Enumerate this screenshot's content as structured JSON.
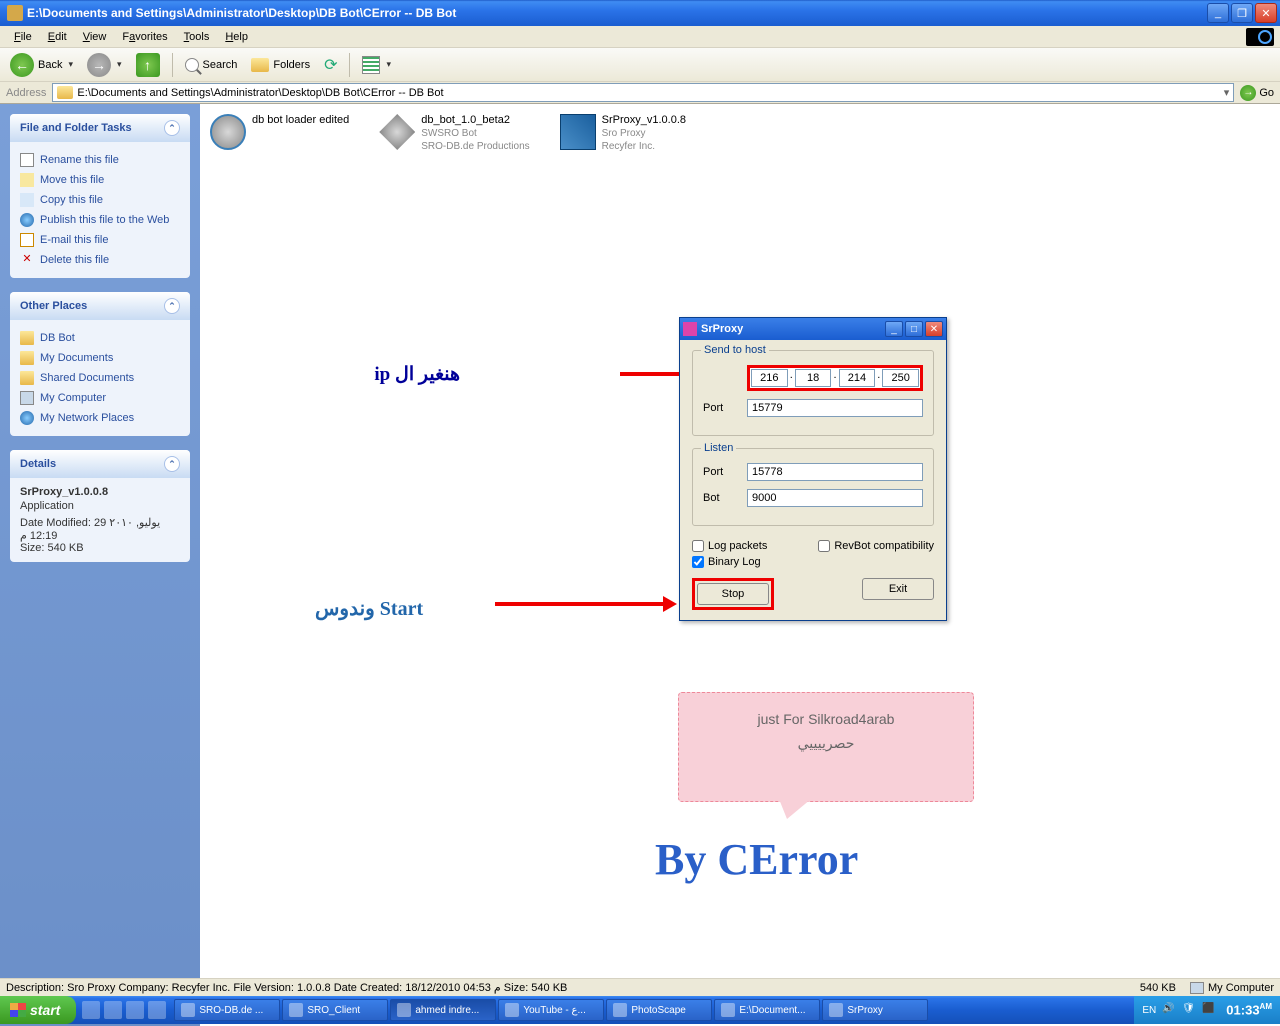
{
  "window": {
    "title": "E:\\Documents and Settings\\Administrator\\Desktop\\DB Bot\\CError -- DB Bot"
  },
  "menu": {
    "file": "File",
    "edit": "Edit",
    "view": "View",
    "favorites": "Favorites",
    "tools": "Tools",
    "help": "Help"
  },
  "toolbar": {
    "back": "Back",
    "search": "Search",
    "folders": "Folders"
  },
  "address": {
    "label": "Address",
    "path": "E:\\Documents and Settings\\Administrator\\Desktop\\DB Bot\\CError -- DB Bot",
    "go": "Go"
  },
  "panels": {
    "tasks": {
      "title": "File and Folder Tasks",
      "rename": "Rename this file",
      "move": "Move this file",
      "copy": "Copy this file",
      "publish": "Publish this file to the Web",
      "email": "E-mail this file",
      "delete": "Delete this file"
    },
    "places": {
      "title": "Other Places",
      "dbbot": "DB Bot",
      "mydocs": "My Documents",
      "shared": "Shared Documents",
      "mycomp": "My Computer",
      "netplaces": "My Network Places"
    },
    "details": {
      "title": "Details",
      "name": "SrProxy_v1.0.0.8",
      "type": "Application",
      "modified": "Date Modified: 29 يوليو, ٢٠١٠ 12:19 م",
      "size": "Size: 540 KB"
    }
  },
  "files": {
    "f1": {
      "name": "db bot loader edited"
    },
    "f2": {
      "name": "db_bot_1.0_beta2",
      "l2": "SWSRO Bot",
      "l3": "SRO-DB.de Productions"
    },
    "f3": {
      "name": "SrProxy_v1.0.0.8",
      "l2": "Sro Proxy",
      "l3": "Recyfer Inc."
    }
  },
  "srproxy": {
    "title": "SrProxy",
    "send_to_host": "Send to host",
    "ip": [
      "216",
      "18",
      "214",
      "250"
    ],
    "port_lbl": "Port",
    "host_port": "15779",
    "listen": "Listen",
    "listen_port": "15778",
    "bot_lbl": "Bot",
    "bot_port": "9000",
    "log_packets": "Log packets",
    "revbot": "RevBot compatibility",
    "binary_log": "Binary Log",
    "stop": "Stop",
    "exit": "Exit"
  },
  "annotations": {
    "ip_txt": "هنغير ال ip",
    "start_txt": "وندوس Start",
    "pink1": "just For Silkroad4arab",
    "pink2": "حصرييييي",
    "by": "By CError"
  },
  "statusbar": {
    "desc": "Description: Sro Proxy Company: Recyfer Inc. File Version: 1.0.0.8 Date Created: 18/12/2010 04:53 م Size: 540 KB",
    "size": "540 KB",
    "loc": "My Computer"
  },
  "taskbar": {
    "start": "start",
    "tasks": [
      "SRO-DB.de ...",
      "SRO_Client",
      "ahmed indre...",
      "YouTube - ع...",
      "PhotoScape",
      "E:\\Document...",
      "SrProxy"
    ],
    "lang": "EN",
    "time": "01:33",
    "ampm": "AM"
  }
}
